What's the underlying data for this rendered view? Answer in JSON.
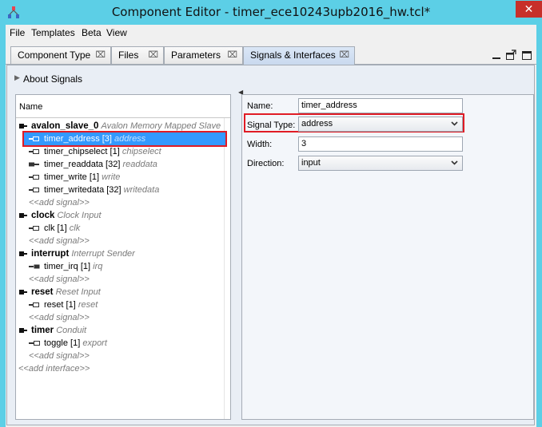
{
  "window": {
    "title": "Component Editor - timer_ece10243upb2016_hw.tcl*",
    "close_glyph": "✕"
  },
  "menu": [
    "File",
    "Templates",
    "Beta",
    "View"
  ],
  "tabs": [
    {
      "label": "Component Type",
      "closable": true
    },
    {
      "label": "Files",
      "closable": true
    },
    {
      "label": "Parameters",
      "closable": true
    },
    {
      "label": "Signals & Interfaces",
      "closable": true,
      "active": true
    }
  ],
  "tab_close_glyph": "⌧",
  "about_signals": {
    "label": "About Signals",
    "arrow": "▶"
  },
  "tree": {
    "header": "Name",
    "interfaces": [
      {
        "name": "avalon_slave_0",
        "type": "Avalon Memory Mapped Slave",
        "signals": [
          {
            "label": "timer_address [3]",
            "type": "address",
            "selected": true
          },
          {
            "label": "timer_chipselect [1]",
            "type": "chipselect"
          },
          {
            "label": "timer_readdata [32]",
            "type": "readdata"
          },
          {
            "label": "timer_write [1]",
            "type": "write"
          },
          {
            "label": "timer_writedata [32]",
            "type": "writedata"
          }
        ],
        "add_signal": "<<add signal>>"
      },
      {
        "name": "clock",
        "type": "Clock Input",
        "signals": [
          {
            "label": "clk [1]",
            "type": "clk"
          }
        ],
        "add_signal": "<<add signal>>"
      },
      {
        "name": "interrupt",
        "type": "Interrupt Sender",
        "signals": [
          {
            "label": "timer_irq [1]",
            "type": "irq"
          }
        ],
        "add_signal": "<<add signal>>"
      },
      {
        "name": "reset",
        "type": "Reset Input",
        "signals": [
          {
            "label": "reset [1]",
            "type": "reset"
          }
        ],
        "add_signal": "<<add signal>>"
      },
      {
        "name": "timer",
        "type": "Conduit",
        "signals": [
          {
            "label": "toggle [1]",
            "type": "export"
          }
        ],
        "add_signal": "<<add signal>>"
      }
    ],
    "add_interface": "<<add interface>>"
  },
  "properties": {
    "name": {
      "label": "Name:",
      "value": "timer_address"
    },
    "signal_type": {
      "label": "Signal Type:",
      "value": "address"
    },
    "width": {
      "label": "Width:",
      "value": "3"
    },
    "direction": {
      "label": "Direction:",
      "value": "input"
    }
  },
  "colors": {
    "titlebar": "#5ccfe6",
    "selection": "#3399ff",
    "highlight_box": "#e01b24",
    "close_button": "#c7302a"
  }
}
